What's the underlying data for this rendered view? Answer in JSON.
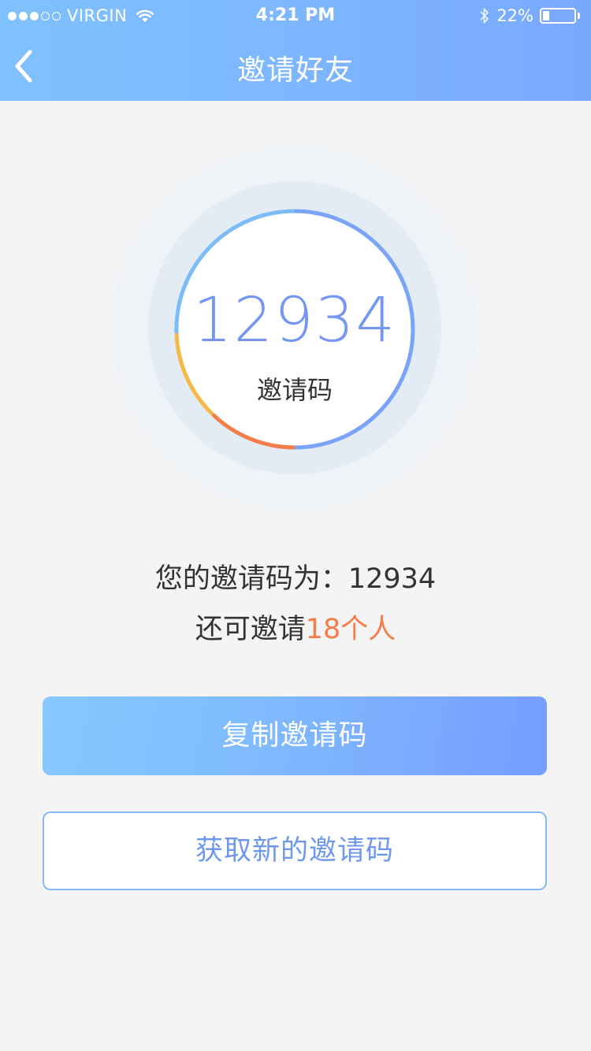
{
  "status_bar": {
    "carrier": "VIRGIN",
    "time": "4:21 PM",
    "battery_text": "22%",
    "battery_level": 0.22,
    "signal_bars_filled": 3,
    "signal_bars_total": 5
  },
  "nav": {
    "back_icon": "chevron-left-icon",
    "title": "邀请好友"
  },
  "invite_card": {
    "code": "12934",
    "label": "邀请码",
    "ring_colors": [
      "#7aa4f7",
      "#7cbcf9",
      "#f6b948",
      "#f47d4a"
    ]
  },
  "info": {
    "code_prefix": "您的邀请码为：",
    "code_value": "12934",
    "remaining_prefix": "还可邀请",
    "remaining_value": "18个人"
  },
  "buttons": {
    "copy_label": "复制邀请码",
    "new_label": "获取新的邀请码"
  },
  "colors": {
    "accent": "#7aa4f7",
    "highlight": "#f47d4a"
  }
}
